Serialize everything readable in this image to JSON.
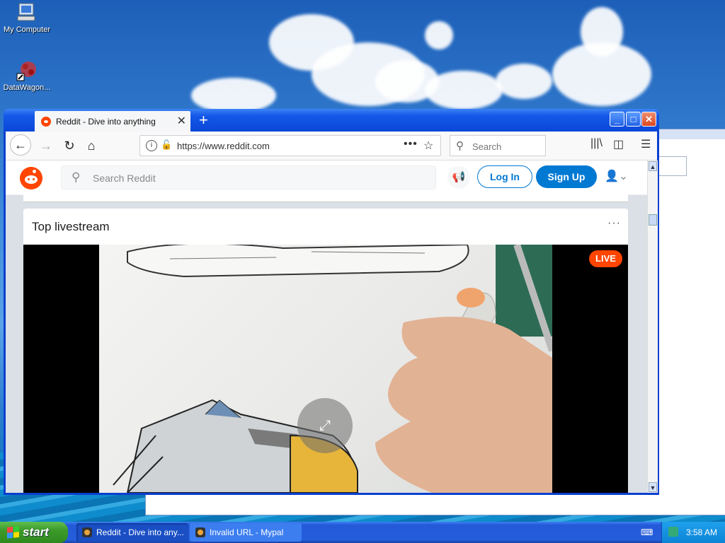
{
  "desktop": {
    "icons": [
      {
        "label": "My Computer"
      },
      {
        "label": "DataWagon..."
      }
    ]
  },
  "browser": {
    "tab_title": "Reddit - Dive into anything",
    "tab_close": "✕",
    "new_tab": "+",
    "window_buttons": {
      "minimize": "_",
      "maximize": "□",
      "close": "✕"
    },
    "url": "https://www.reddit.com",
    "url_more": "•••",
    "bookmark_star": "☆",
    "search_placeholder": "Search",
    "nav": {
      "back": "←",
      "forward": "→",
      "reload": "↻",
      "home": "⌂"
    },
    "toolbar_icons": {
      "library": "|||\\",
      "sidebar": "◫",
      "menu": "☰"
    }
  },
  "reddit": {
    "search_placeholder": "Search Reddit",
    "login_label": "Log In",
    "signup_label": "Sign Up",
    "section_title": "Top livestream",
    "section_menu": "···",
    "live_badge": "LIVE"
  },
  "taskbar": {
    "start_label": "start",
    "tasks": [
      {
        "label": "Reddit - Dive into any..."
      },
      {
        "label": "Invalid URL - Mypal"
      }
    ],
    "clock": "3:58 AM"
  },
  "colors": {
    "reddit_orange": "#ff4500",
    "reddit_blue": "#0079d3",
    "xp_blue": "#0a47d8"
  }
}
